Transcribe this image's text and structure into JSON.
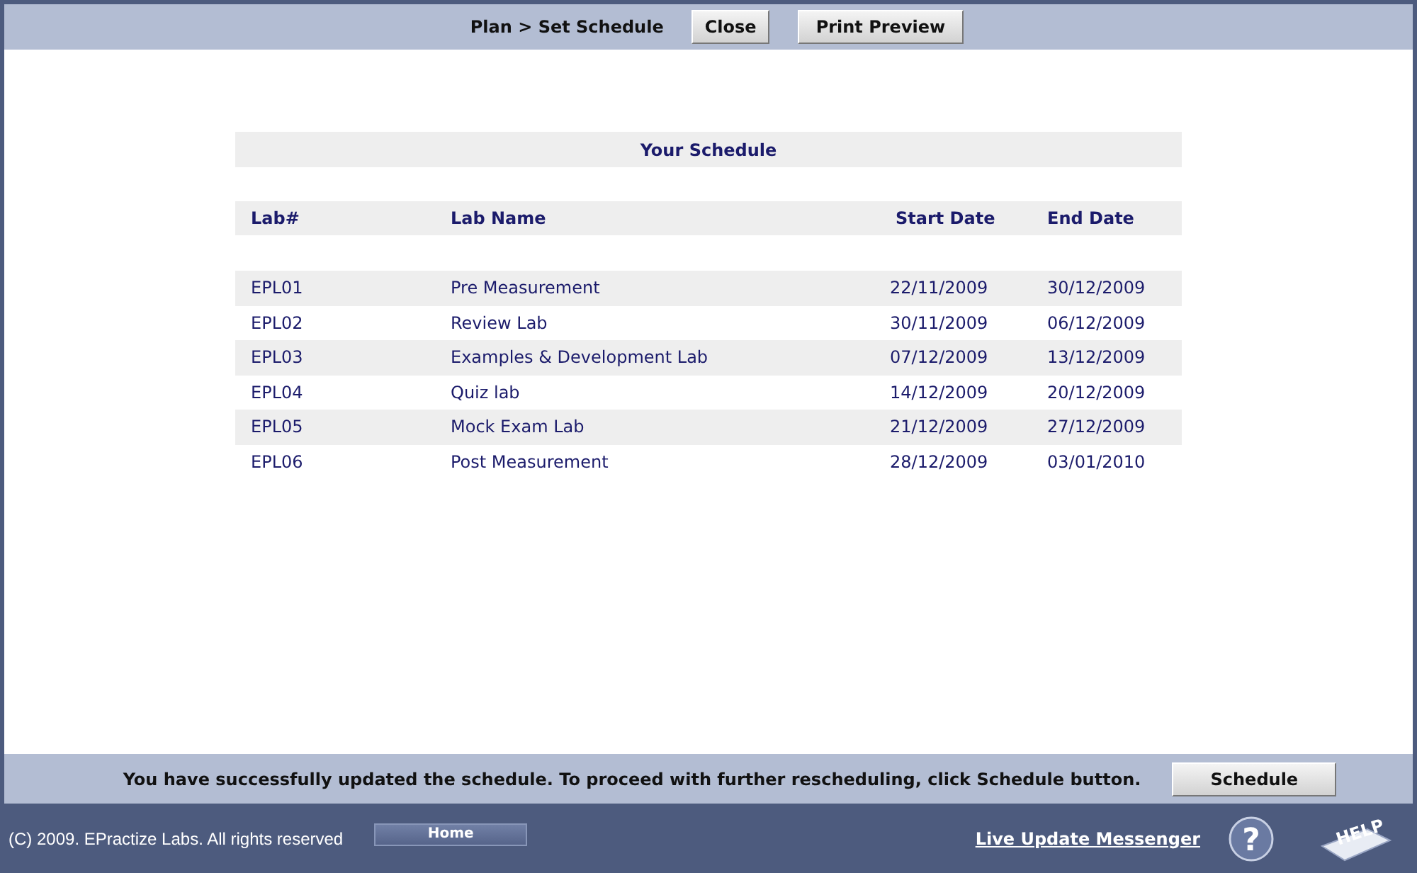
{
  "top_bar": {
    "breadcrumb": "Plan > Set Schedule",
    "buttons": [
      "Close",
      "Print Preview"
    ]
  },
  "schedule": {
    "title": "Your Schedule",
    "columns": [
      "Lab#",
      "Lab Name",
      "Start Date",
      "End Date"
    ],
    "rows": [
      [
        "EPL01",
        "Pre Measurement",
        "22/11/2009",
        "30/12/2009"
      ],
      [
        "EPL02",
        "Review Lab",
        "30/11/2009",
        "06/12/2009"
      ],
      [
        "EPL03",
        "Examples & Development Lab",
        "07/12/2009",
        "13/12/2009"
      ],
      [
        "EPL04",
        "Quiz lab",
        "14/12/2009",
        "20/12/2009"
      ],
      [
        "EPL05",
        "Mock Exam Lab",
        "21/12/2009",
        "27/12/2009"
      ],
      [
        "EPL06",
        "Post Measurement",
        "28/12/2009",
        "03/01/2010"
      ]
    ]
  },
  "message_bar": {
    "message": "You have successfully updated the schedule. To proceed with further rescheduling, click Schedule button.",
    "button": "Schedule"
  },
  "footer": {
    "copyright": "(C) 2009. EPractize Labs. All rights reserved",
    "home": "Home",
    "link": "Live Update Messenger",
    "help_glyph": "?",
    "help_logo": "HELP"
  }
}
